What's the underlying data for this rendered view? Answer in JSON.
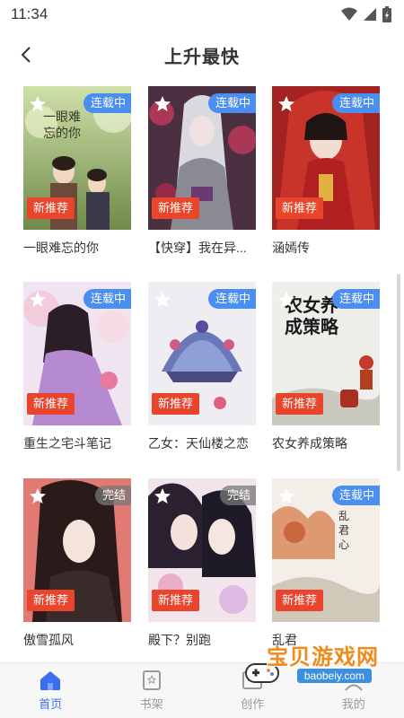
{
  "status_bar": {
    "time": "11:34"
  },
  "header": {
    "title": "上升最快"
  },
  "books": [
    {
      "title": "一眼难忘的你",
      "status": "连载中",
      "tag": "新推荐",
      "cover_text": "一眼难忘的你"
    },
    {
      "title": "【快穿】我在异...",
      "status": "连载中",
      "tag": "新推荐"
    },
    {
      "title": "涵嫣传",
      "status": "连载中",
      "tag": "新推荐"
    },
    {
      "title": "重生之宅斗笔记",
      "status": "连载中",
      "tag": "新推荐"
    },
    {
      "title": "乙女：天仙楼之恋",
      "status": "连载中",
      "tag": "新推荐"
    },
    {
      "title": "农女养成策略",
      "status": "连载中",
      "tag": "新推荐",
      "cover_text": "农女养成策略"
    },
    {
      "title": "傲雪孤风",
      "status": "完结",
      "tag": "新推荐"
    },
    {
      "title": "殿下？别跑",
      "status": "完结",
      "tag": "新推荐"
    },
    {
      "title": "乱君",
      "status": "连载中",
      "tag": "新推荐",
      "cover_text": "乱君心"
    }
  ],
  "tabbar": {
    "tabs": [
      {
        "label": "首页"
      },
      {
        "label": "书架"
      },
      {
        "label": "创作"
      },
      {
        "label": "我的"
      }
    ]
  },
  "watermark": {
    "title": "宝贝游戏网",
    "url": "baobeiy.com"
  },
  "colors": {
    "accent": "#3b6df2",
    "ongoing": "#4a8ef0",
    "recommend": "#e8452c"
  }
}
